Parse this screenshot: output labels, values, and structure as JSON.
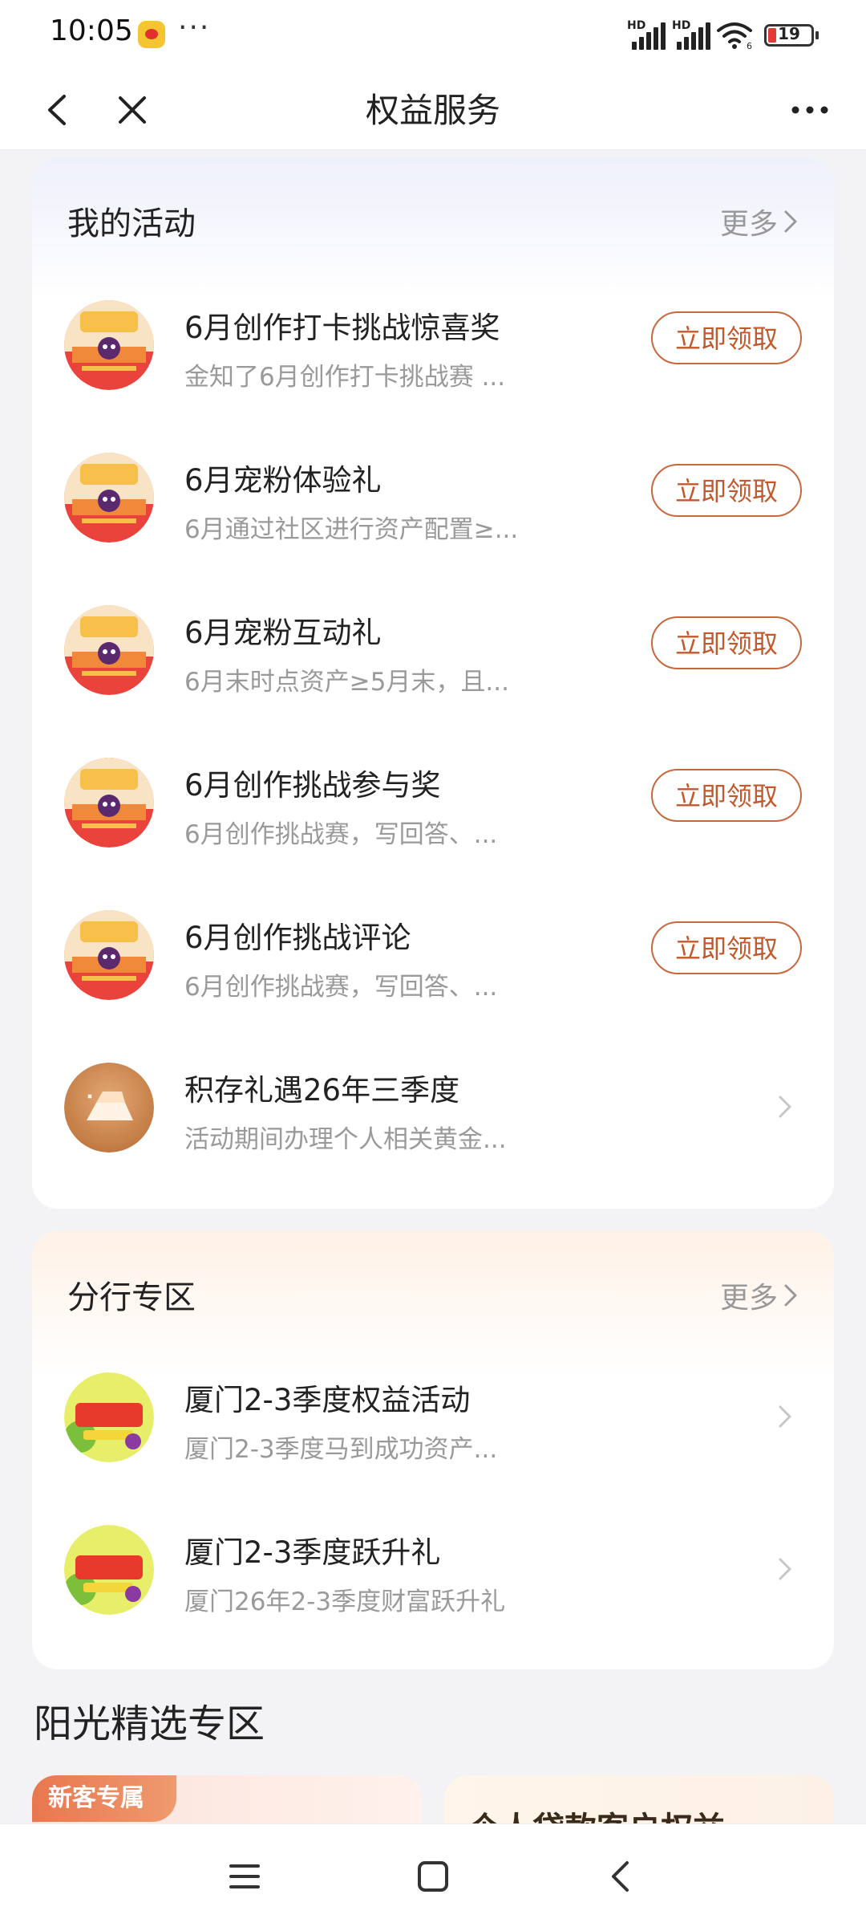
{
  "status_bar": {
    "time": "10:05",
    "app_icon": "weibo-icon",
    "overflow": "···",
    "hd1": "HD",
    "hd2": "HD",
    "wifi_label": "6",
    "battery": "19"
  },
  "nav": {
    "title": "权益服务",
    "back_icon": "back-arrow-icon",
    "close_icon": "close-icon",
    "more_icon": "more-dots-icon"
  },
  "my_activities": {
    "title": "我的活动",
    "more": "更多",
    "items": [
      {
        "title": "6月创作打卡挑战惊喜奖",
        "subtitle": "金知了6月创作打卡挑战赛 ...",
        "action": "立即领取"
      },
      {
        "title": "6月宠粉体验礼",
        "subtitle": "6月通过社区进行资产配置≥...",
        "action": "立即领取"
      },
      {
        "title": "6月宠粉互动礼",
        "subtitle": "6月末时点资产≥5月末，且...",
        "action": "立即领取"
      },
      {
        "title": "6月创作挑战参与奖",
        "subtitle": "6月创作挑战赛，写回答、...",
        "action": "立即领取"
      },
      {
        "title": "6月创作挑战评论",
        "subtitle": "6月创作挑战赛，写回答、...",
        "action": "立即领取"
      },
      {
        "title": "积存礼遇26年三季度",
        "subtitle": "活动期间办理个人相关黄金..."
      }
    ]
  },
  "branch": {
    "title": "分行专区",
    "more": "更多",
    "items": [
      {
        "title": "厦门2-3季度权益活动",
        "subtitle": "厦门2-3季度马到成功资产..."
      },
      {
        "title": "厦门2-3季度跃升礼",
        "subtitle": "厦门26年2-3季度财富跃升礼"
      }
    ]
  },
  "sunshine": {
    "title": "阳光精选专区",
    "promo_tag": "新客专属",
    "promo2_text": "个人贷款客户权益"
  },
  "colors": {
    "accent": "#c4582b",
    "background": "#f3f3f5"
  }
}
